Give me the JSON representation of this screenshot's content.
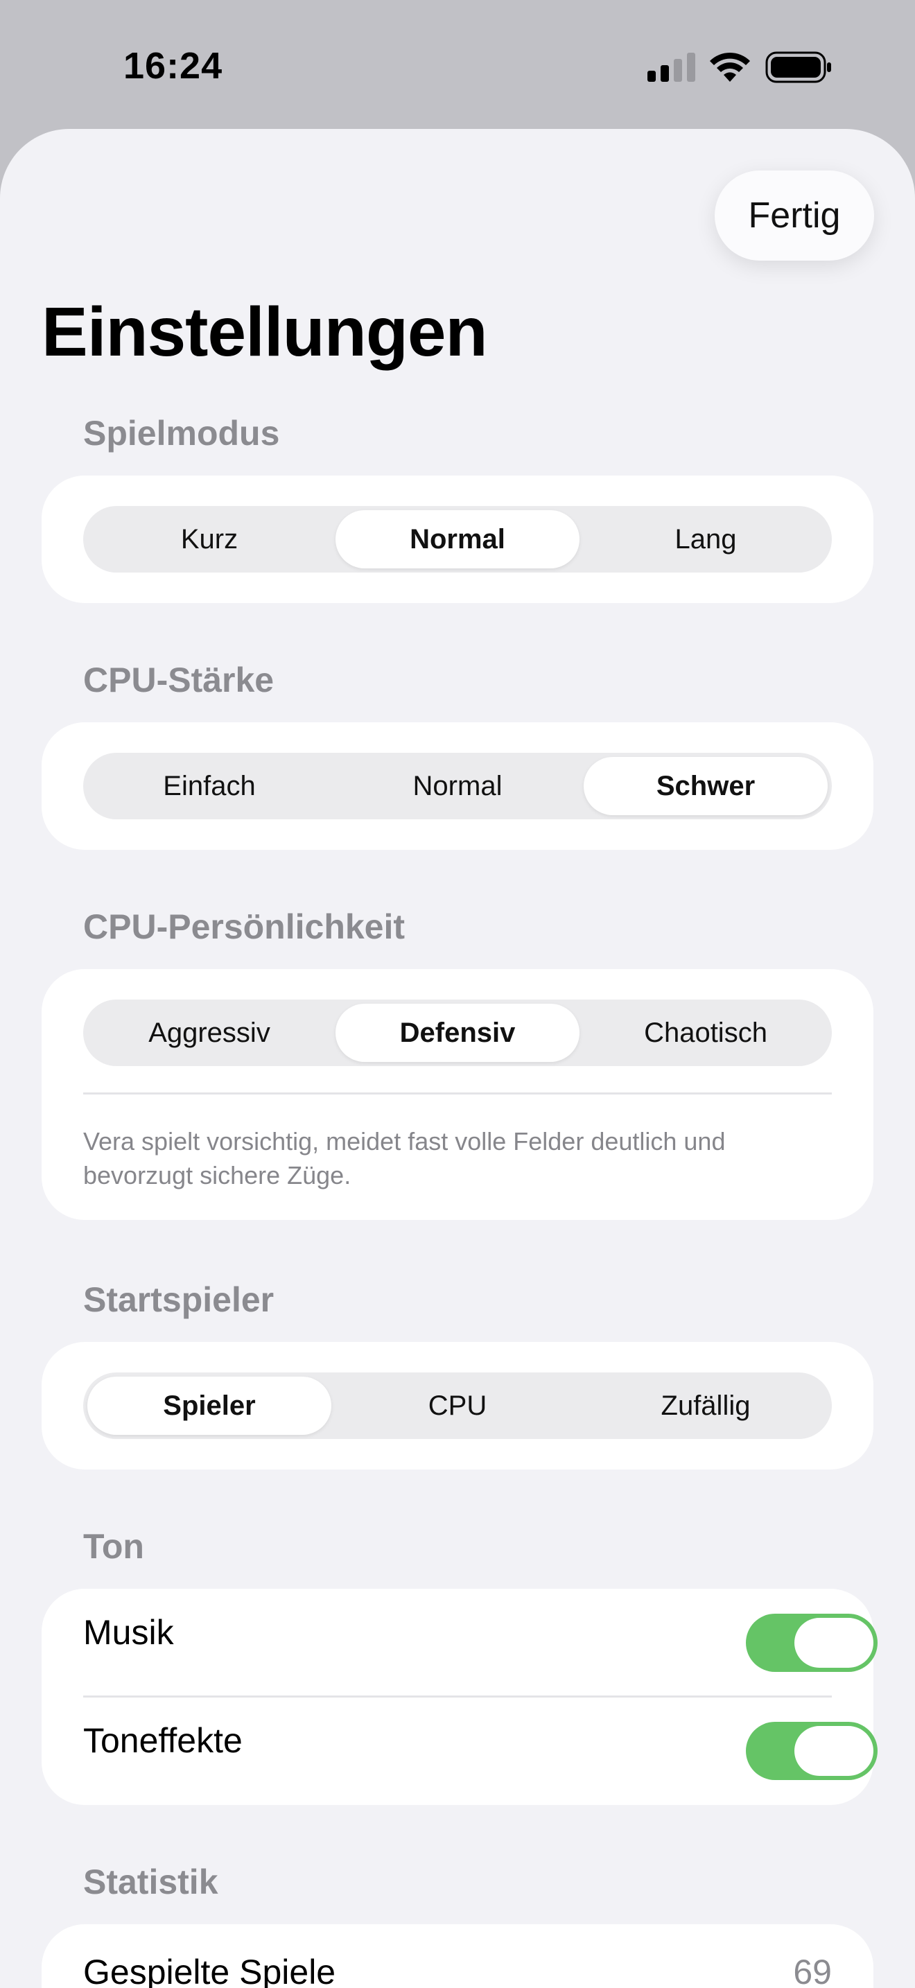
{
  "status_bar": {
    "time": "16:24",
    "icons": [
      "signal-icon",
      "wifi-icon",
      "battery-icon"
    ]
  },
  "header": {
    "done_label": "Fertig",
    "title": "Einstellungen"
  },
  "game_mode": {
    "header": "Spielmodus",
    "options": [
      "Kurz",
      "Normal",
      "Lang"
    ],
    "selected": "Normal"
  },
  "cpu_strength": {
    "header": "CPU-Stärke",
    "options": [
      "Einfach",
      "Normal",
      "Schwer"
    ],
    "selected": "Schwer"
  },
  "cpu_personality": {
    "header": "CPU-Persönlichkeit",
    "options": [
      "Aggressiv",
      "Defensiv",
      "Chaotisch"
    ],
    "selected": "Defensiv",
    "description": "Vera spielt vorsichtig, meidet fast volle Felder deutlich und bevorzugt sichere Züge."
  },
  "start_player": {
    "header": "Startspieler",
    "options": [
      "Spieler",
      "CPU",
      "Zufällig"
    ],
    "selected": "Spieler"
  },
  "sound": {
    "header": "Ton",
    "rows": [
      {
        "label": "Musik",
        "on": true
      },
      {
        "label": "Toneffekte",
        "on": true
      }
    ]
  },
  "statistics": {
    "header": "Statistik",
    "rows": [
      {
        "label": "Gespielte Spiele",
        "value": "69"
      }
    ]
  },
  "colors": {
    "toggle_on": "#65c466",
    "background": "#f2f2f6",
    "card": "#ffffff",
    "secondary_text": "#8b8b90"
  }
}
